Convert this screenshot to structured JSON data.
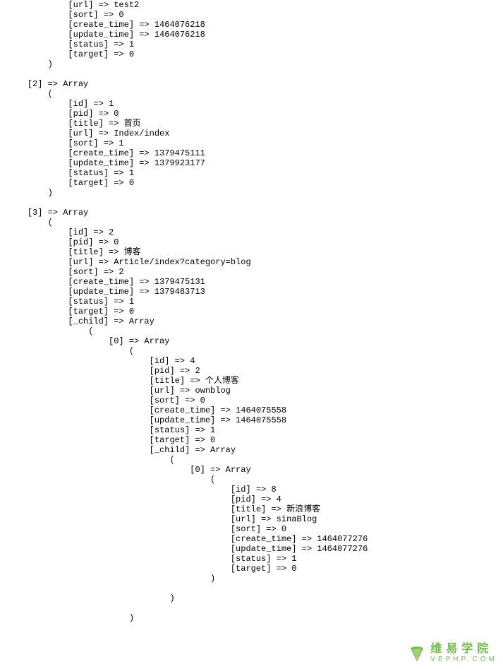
{
  "watermark": {
    "cn": "维易学院",
    "en": "VEPHP.COM"
  },
  "dump_lines": [
    "            [url] => test2",
    "            [sort] => 0",
    "            [create_time] => 1464076218",
    "            [update_time] => 1464076218",
    "            [status] => 1",
    "            [target] => 0",
    "        )",
    "",
    "    [2] => Array",
    "        (",
    "            [id] => 1",
    "            [pid] => 0",
    "            [title] => 首页",
    "            [url] => Index/index",
    "            [sort] => 1",
    "            [create_time] => 1379475111",
    "            [update_time] => 1379923177",
    "            [status] => 1",
    "            [target] => 0",
    "        )",
    "",
    "    [3] => Array",
    "        (",
    "            [id] => 2",
    "            [pid] => 0",
    "            [title] => 博客",
    "            [url] => Article/index?category=blog",
    "            [sort] => 2",
    "            [create_time] => 1379475131",
    "            [update_time] => 1379483713",
    "            [status] => 1",
    "            [target] => 0",
    "            [_child] => Array",
    "                (",
    "                    [0] => Array",
    "                        (",
    "                            [id] => 4",
    "                            [pid] => 2",
    "                            [title] => 个人博客",
    "                            [url] => ownblog",
    "                            [sort] => 0",
    "                            [create_time] => 1464075558",
    "                            [update_time] => 1464075558",
    "                            [status] => 1",
    "                            [target] => 0",
    "                            [_child] => Array",
    "                                (",
    "                                    [0] => Array",
    "                                        (",
    "                                            [id] => 8",
    "                                            [pid] => 4",
    "                                            [title] => 新浪博客",
    "                                            [url] => sinaBlog",
    "                                            [sort] => 0",
    "                                            [create_time] => 1464077276",
    "                                            [update_time] => 1464077276",
    "                                            [status] => 1",
    "                                            [target] => 0",
    "                                        )",
    "",
    "                                )",
    "",
    "                        )"
  ]
}
